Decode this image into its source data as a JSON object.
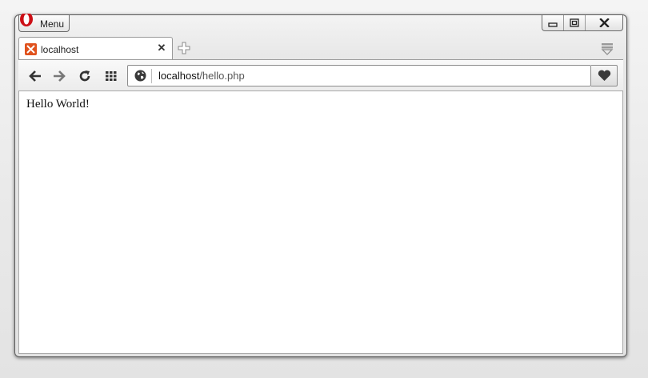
{
  "menu": {
    "label": "Menu",
    "logo_icon": "opera-logo-icon"
  },
  "window_controls": {
    "minimize_icon": "minimize-icon",
    "maximize_icon": "maximize-icon",
    "close_icon": "close-icon"
  },
  "tabs": [
    {
      "title": "localhost",
      "favicon": "xampp-icon",
      "close_glyph": "✕"
    }
  ],
  "address_bar": {
    "host": "localhost",
    "path": "/hello.php",
    "security_icon": "globe-icon"
  },
  "toolbar": {
    "back_icon": "back-arrow-icon",
    "forward_icon": "forward-arrow-icon",
    "reload_icon": "reload-icon",
    "speed_dial_icon": "speed-dial-grid-icon",
    "bookmark_icon": "heart-icon"
  },
  "page": {
    "body_text": "Hello World!"
  },
  "colors": {
    "opera_red": "#cc0f16",
    "xampp_orange": "#e0521d"
  }
}
